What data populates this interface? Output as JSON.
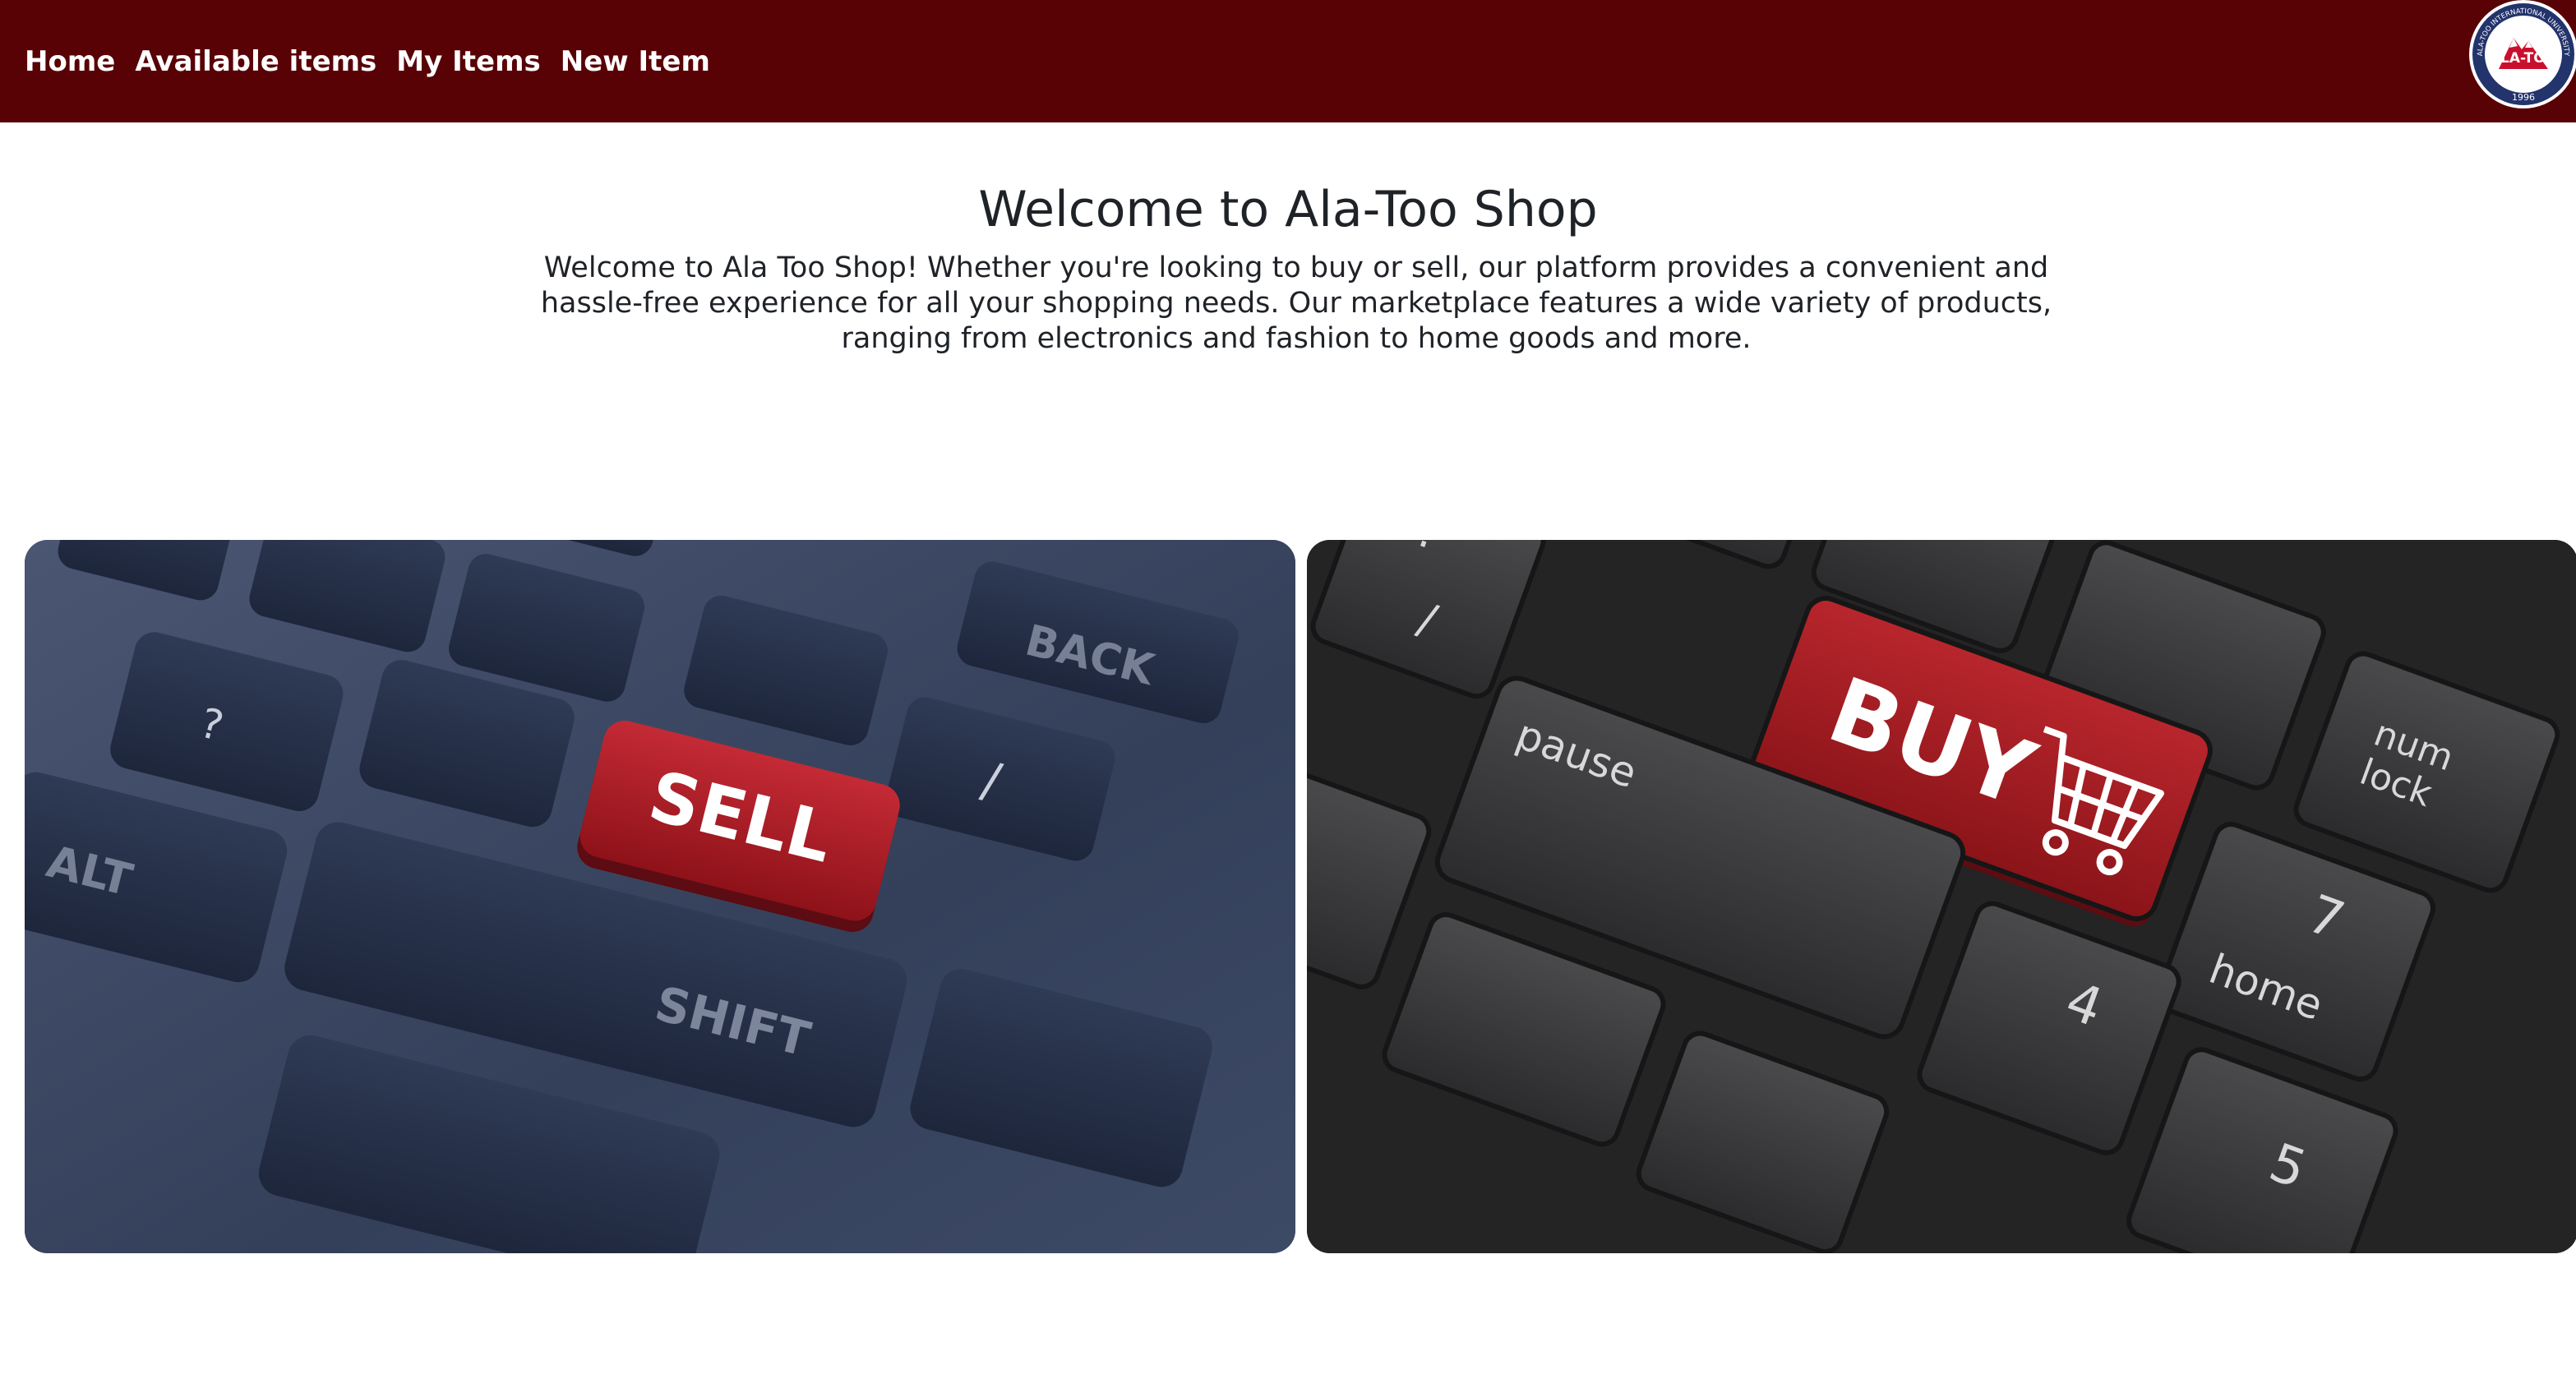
{
  "nav": {
    "items": [
      "Home",
      "Available items",
      "My Items",
      "New Item"
    ],
    "logo": {
      "label": "ALA-TOO",
      "ring_text": "ALA-TOO INTERNATIONAL UNIVERSITY",
      "year": "1996"
    }
  },
  "main": {
    "title": "Welcome to Ala-Too Shop",
    "intro": "Welcome to Ala Too Shop! Whether you're looking to buy or sell, our platform provides a convenient and hassle-free experience for all your shopping needs. Our marketplace features a wide variety of products, ranging from electronics and fashion to home goods and more."
  },
  "images": {
    "sell": {
      "button_text": "SELL",
      "keys": [
        "BACK",
        "ALT",
        "SHIFT",
        "?",
        "/"
      ]
    },
    "buy": {
      "button_text": "BUY",
      "keys": [
        "pause",
        "num lock",
        "7",
        "home",
        "4",
        "5",
        "?",
        "/",
        "“"
      ]
    }
  },
  "colors": {
    "navbar": "#580206",
    "accent_red": "#a3171d",
    "text": "#1f2328"
  }
}
